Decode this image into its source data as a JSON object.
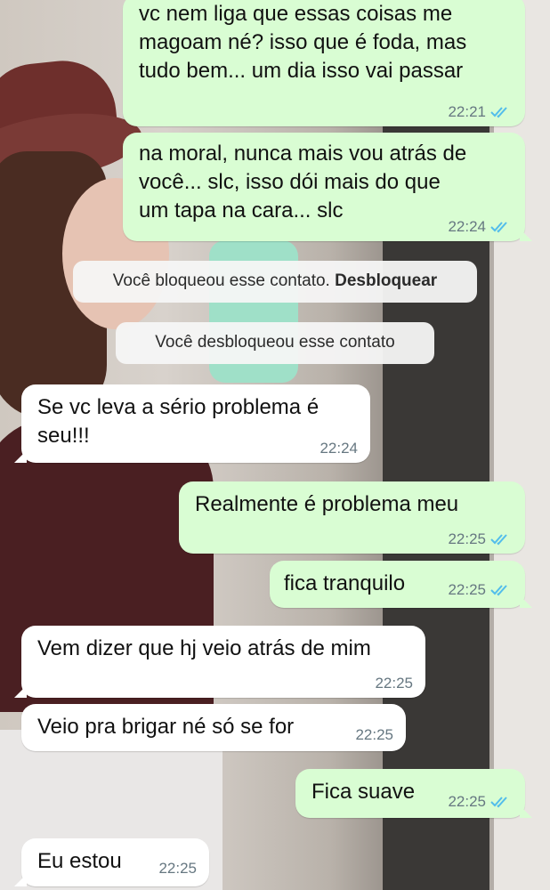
{
  "conversation": {
    "messages": [
      {
        "dir": "out",
        "text": "vc nem liga que essas coisas me\nmagoam né? isso que é foda, mas\ntudo bem... um dia isso vai passar",
        "time": "22:21",
        "read": true
      },
      {
        "dir": "out",
        "text": "na moral, nunca mais vou atrás de\nvocê...  slc, isso dói mais do que\num tapa na cara... slc",
        "time": "22:24",
        "read": true
      },
      {
        "dir": "in",
        "text": "Se vc leva a sério problema é\nseu!!!",
        "time": "22:24"
      },
      {
        "dir": "out",
        "text": "Realmente é problema meu",
        "time": "22:25",
        "read": true
      },
      {
        "dir": "out",
        "text": "fica tranquilo",
        "time": "22:25",
        "read": true
      },
      {
        "dir": "in",
        "text": "Vem dizer que hj veio atrás de mim",
        "time": "22:25"
      },
      {
        "dir": "in",
        "text": "Veio pra brigar né só se for",
        "time": "22:25"
      },
      {
        "dir": "out",
        "text": "Fica suave",
        "time": "22:25",
        "read": true
      },
      {
        "dir": "in",
        "text": "Eu estou",
        "time": "22:25"
      }
    ],
    "system_notices": {
      "blocked_text": "Você bloqueou esse contato.",
      "unblock_action": "Desbloquear",
      "unblocked_text": "Você desbloqueou esse contato"
    }
  },
  "colors": {
    "outgoing_bubble": "#d9fdd3",
    "incoming_bubble": "#ffffff",
    "read_ticks": "#53bdeb"
  },
  "icons": {
    "read_receipt": "double-check-icon"
  }
}
